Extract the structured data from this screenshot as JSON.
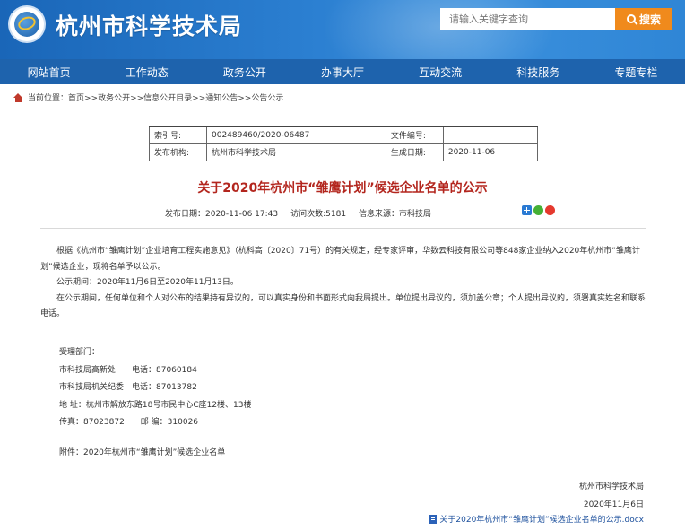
{
  "header": {
    "site_title": "杭州市科学技术局",
    "search_placeholder": "请输入关键字查询",
    "search_button": "搜索"
  },
  "nav": [
    "网站首页",
    "工作动态",
    "政务公开",
    "办事大厅",
    "互动交流",
    "科技服务",
    "专题专栏"
  ],
  "breadcrumb": "当前位置：首页>>政务公开>>信息公开目录>>通知公告>>公告公示",
  "meta": {
    "index_label": "索引号:",
    "index_value": "002489460/2020-06487",
    "docno_label": "文件编号:",
    "docno_value": "",
    "publisher_label": "发布机构:",
    "publisher_value": "杭州市科学技术局",
    "date_label": "生成日期:",
    "date_value": "2020-11-06"
  },
  "article": {
    "title": "关于2020年杭州市“雏鹰计划”候选企业名单的公示",
    "publish_date": "发布日期：2020-11-06 17:43",
    "views": "访问次数:5181",
    "source": "信息来源：市科技局",
    "paragraphs": [
      "根据《杭州市“雏鹰计划”企业培育工程实施意见》（杭科高〔2020〕71号）的有关规定，经专家评审，华数云科技有限公司等848家企业纳入2020年杭州市“雏鹰计划”候选企业，现将名单予以公示。",
      "公示期间：2020年11月6日至2020年11月13日。",
      "在公示期间，任何单位和个人对公布的结果持有异议的，可以真实身份和书面形式向我局提出。单位提出异议的，须加盖公章；个人提出异议的，须署真实姓名和联系电话。"
    ],
    "contact": [
      "受理部门：",
      "市科技局高新处　　电话：87060184",
      "市科技局机关纪委　电话：87013782",
      "地  址：杭州市解放东路18号市民中心C座12楼、13楼",
      "传真：87023872　　邮  编：310026"
    ],
    "attachment": "附件：2020年杭州市“雏鹰计划”候选企业名单",
    "signoff_org": "杭州市科学技术局",
    "signoff_date": "2020年11月6日",
    "file_link": "关于2020年杭州市“雏鹰计划”候选企业名单的公示.docx"
  },
  "colors": {
    "header_blue": "#2b7fd1",
    "nav_blue": "#1e63ad",
    "search_orange": "#f08a1c",
    "title_red": "#b3261e",
    "link_blue": "#1b4f9c"
  }
}
